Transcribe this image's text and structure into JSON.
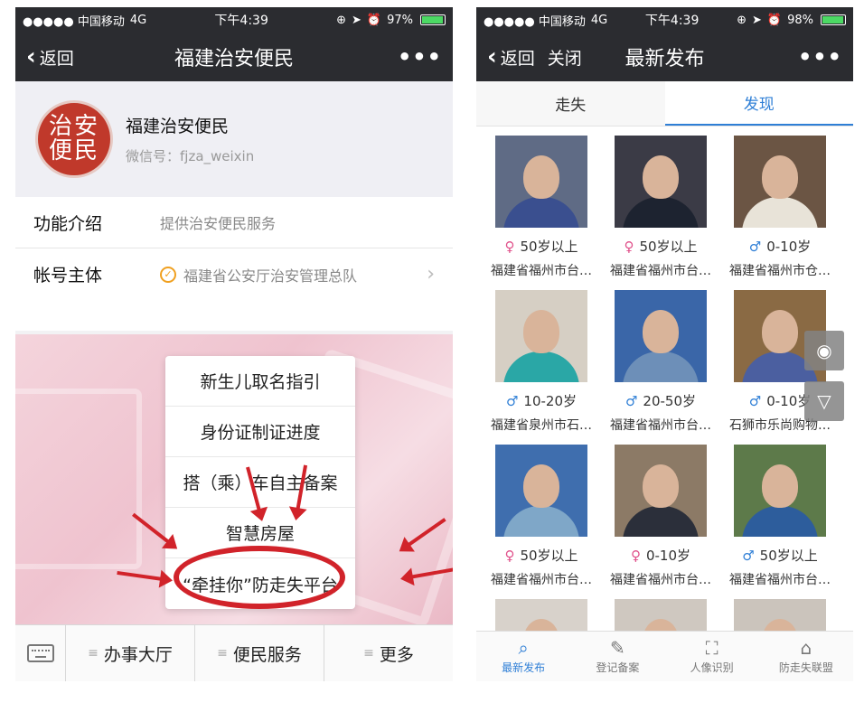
{
  "left": {
    "status": {
      "carrier": "●●●●● 中国移动",
      "network": "4G",
      "time": "下午4:39",
      "battery": "97%",
      "battery_level": 0.97
    },
    "nav": {
      "back": "返回",
      "title": "福建治安便民",
      "more": "•••"
    },
    "profile": {
      "avatar_text": [
        "治安",
        "便民"
      ],
      "name": "福建治安便民",
      "wechat_id": "微信号：fjza_weixin"
    },
    "info": [
      {
        "label": "功能介绍",
        "value": "提供治安便民服务"
      },
      {
        "label": "帐号主体",
        "value": "福建省公安厅治安管理总队"
      }
    ],
    "popup_menu": [
      "新生儿取名指引",
      "身份证制证进度",
      "搭（乘）车自主备案",
      "智慧房屋",
      "“牵挂你”防走失平台"
    ],
    "bottom_menu": [
      "办事大厅",
      "便民服务",
      "更多"
    ]
  },
  "right": {
    "status": {
      "carrier": "●●●●● 中国移动",
      "network": "4G",
      "time": "下午4:39",
      "battery": "98%",
      "battery_level": 0.98
    },
    "nav": {
      "back": "返回",
      "close": "关闭",
      "title": "最新发布",
      "more": "•••"
    },
    "tabs": [
      "走失",
      "发现"
    ],
    "active_tab": "发现",
    "cards": [
      {
        "gender": "female",
        "age": "50岁以上",
        "location": "福建省福州市台…"
      },
      {
        "gender": "female",
        "age": "50岁以上",
        "location": "福建省福州市台…"
      },
      {
        "gender": "male",
        "age": "0-10岁",
        "location": "福建省福州市仓…"
      },
      {
        "gender": "male",
        "age": "10-20岁",
        "location": "福建省泉州市石…"
      },
      {
        "gender": "male",
        "age": "20-50岁",
        "location": "福建省福州市台…"
      },
      {
        "gender": "male",
        "age": "0-10岁",
        "location": "石狮市乐尚购物…"
      },
      {
        "gender": "female",
        "age": "50岁以上",
        "location": "福建省福州市台…"
      },
      {
        "gender": "female",
        "age": "0-10岁",
        "location": "福建省福州市台…"
      },
      {
        "gender": "male",
        "age": "50岁以上",
        "location": "福建省福州市台…"
      }
    ],
    "tabbar": [
      {
        "label": "最新发布",
        "icon": "search-icon",
        "active": true
      },
      {
        "label": "登记备案",
        "icon": "pencil-icon",
        "active": false
      },
      {
        "label": "人像识别",
        "icon": "face-scan-icon",
        "active": false
      },
      {
        "label": "防走失联盟",
        "icon": "home-plus-icon",
        "active": false
      }
    ],
    "colors": {
      "accent": "#2f7fd6",
      "female": "#e0508a",
      "male": "#2f7fd6"
    }
  }
}
